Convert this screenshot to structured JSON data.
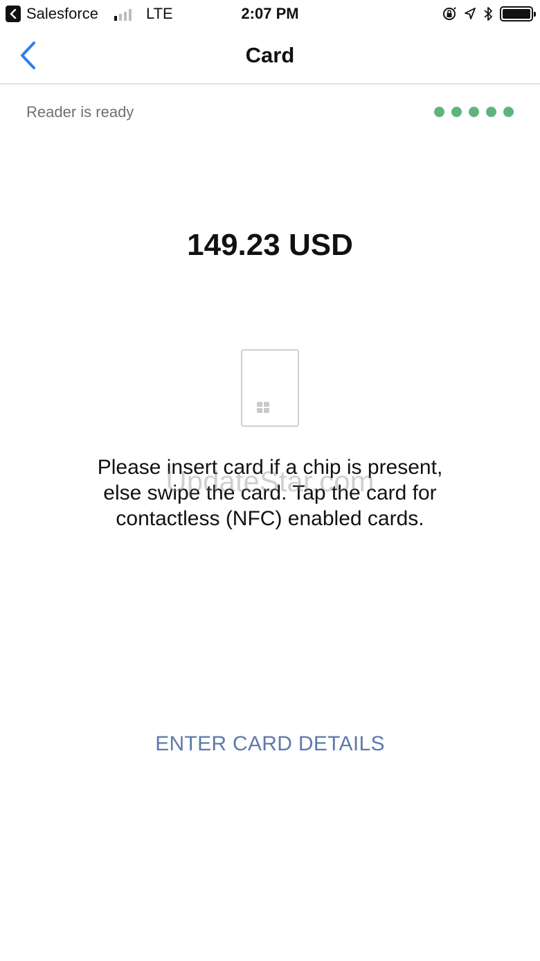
{
  "status_bar": {
    "back_app": "Salesforce",
    "network": "LTE",
    "time": "2:07 PM",
    "icons": [
      "orientation-lock-icon",
      "location-icon",
      "bluetooth-icon",
      "battery-icon"
    ],
    "battery_level": 1.0
  },
  "nav": {
    "back_icon": "chevron-left-icon",
    "title": "Card"
  },
  "reader": {
    "status_text": "Reader is ready",
    "indicator_dots": 5,
    "indicator_color": "#5fb47e"
  },
  "payment": {
    "amount": "149.23 USD"
  },
  "card_illustration": {
    "icon": "card-chip-icon"
  },
  "instructions": {
    "line1": "Please insert card if a chip is present,",
    "line2": "else swipe the card. Tap the card for",
    "line3": "contactless (NFC) enabled cards."
  },
  "watermark": {
    "text": "UpdateStar.com"
  },
  "actions": {
    "enter_card_details": "ENTER CARD DETAILS",
    "link_color": "#5e79ad"
  }
}
